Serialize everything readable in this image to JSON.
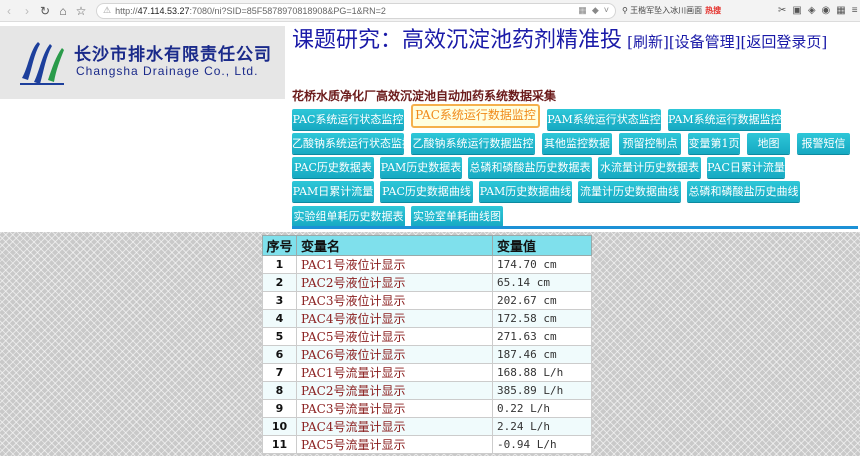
{
  "browser": {
    "url_prefix": "http://",
    "url_host": "47.114.53.27",
    "url_rest": ":7080/ni?SID=85F5878970818908&PG=1&RN=2",
    "search_text": "王楷军坠入冰川画面",
    "search_badge": "热搜"
  },
  "company": {
    "name_cn": "长沙市排水有限责任公司",
    "name_en": "Changsha Drainage Co., Ltd."
  },
  "header": {
    "title": "课题研究：高效沉淀池药剂精准投",
    "link_refresh": "[刷新]",
    "link_device": "[设备管理]",
    "link_back": "[返回登录页]",
    "subtitle": "花桥水质净化厂高效沉淀池自动加药系统数据采集"
  },
  "nav": [
    "PAC系统运行状态监控",
    "PAC系统运行数据监控",
    "PAM系统运行状态监控",
    "PAM系统运行数据监控",
    "乙酸钠系统运行状态监控",
    "乙酸钠系统运行数据监控",
    "其他监控数据",
    "预留控制点",
    "变量第1页",
    "地图",
    "报警短信",
    "PAC历史数据表",
    "PAM历史数据表",
    "总磷和磷酸盐历史数据表",
    "水流量计历史数据表",
    "PAC日累计流量",
    "PAM日累计流量",
    "PAC历史数据曲线",
    "PAM历史数据曲线",
    "流量计历史数据曲线",
    "总磷和磷酸盐历史曲线",
    "实验组单耗历史数据表",
    "实验室单耗曲线图"
  ],
  "table": {
    "headers": [
      "序号",
      "变量名",
      "变量值"
    ],
    "rows": [
      {
        "idx": "1",
        "name": "PAC1号液位计显示",
        "value": "174.70 cm"
      },
      {
        "idx": "2",
        "name": "PAC2号液位计显示",
        "value": "65.14 cm"
      },
      {
        "idx": "3",
        "name": "PAC3号液位计显示",
        "value": "202.67 cm"
      },
      {
        "idx": "4",
        "name": "PAC4号液位计显示",
        "value": "172.58 cm"
      },
      {
        "idx": "5",
        "name": "PAC5号液位计显示",
        "value": "271.63 cm"
      },
      {
        "idx": "6",
        "name": "PAC6号液位计显示",
        "value": "187.46 cm"
      },
      {
        "idx": "7",
        "name": "PAC1号流量计显示",
        "value": "168.88 L/h"
      },
      {
        "idx": "8",
        "name": "PAC2号流量计显示",
        "value": "385.89 L/h"
      },
      {
        "idx": "9",
        "name": "PAC3号流量计显示",
        "value": "0.22 L/h"
      },
      {
        "idx": "10",
        "name": "PAC4号流量计显示",
        "value": "2.24 L/h"
      },
      {
        "idx": "11",
        "name": "PAC5号流量计显示",
        "value": "-0.94 L/h"
      }
    ]
  },
  "colors": {
    "nav_button": "#1cb5cb",
    "nav_active_text": "#f08a1a",
    "title": "#1a1aa8",
    "table_header": "#7fe0ec",
    "variable_name": "#8b2020"
  }
}
